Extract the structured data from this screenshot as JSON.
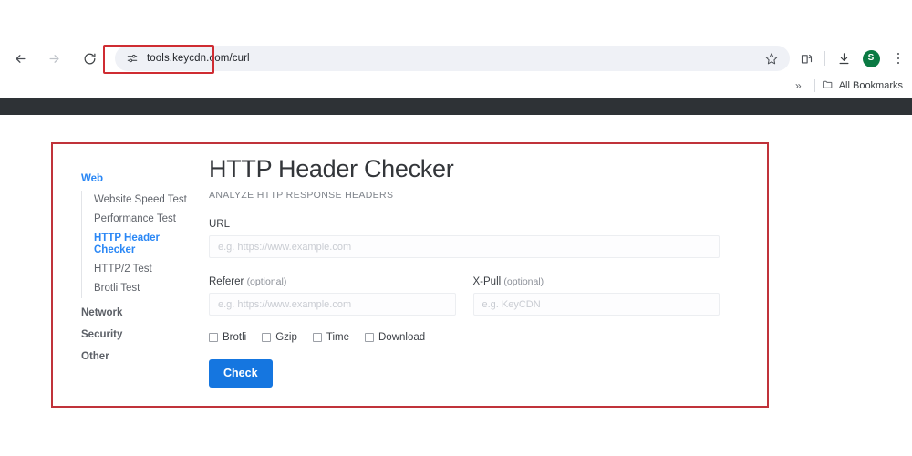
{
  "browser": {
    "nav": {
      "back_icon": "arrow-left-icon",
      "forward_icon": "arrow-right-icon",
      "reload_icon": "reload-icon"
    },
    "omnibox": {
      "site_settings_icon": "tune-sliders-icon",
      "url": "tools.keycdn.com/curl",
      "bookmark_icon": "star-icon"
    },
    "toolbar_right": {
      "share_icon": "share-screen-icon",
      "downloads_icon": "download-icon",
      "profile_initial": "S",
      "menu_icon": "kebab-menu-icon"
    },
    "bookmarks_bar": {
      "overflow_label": "»",
      "folder_icon": "folder-icon",
      "all_bookmarks_label": "All Bookmarks"
    }
  },
  "annotations": {
    "url_highlight_color": "#cf2c32",
    "panel_highlight_color": "#c0323a"
  },
  "site": {
    "navbar_color": "#2e3236",
    "sidebar": {
      "groups": [
        {
          "label": "Web",
          "active": true,
          "items": [
            {
              "label": "Website Speed Test",
              "active": false
            },
            {
              "label": "Performance Test",
              "active": false
            },
            {
              "label": "HTTP Header Checker",
              "active": true
            },
            {
              "label": "HTTP/2 Test",
              "active": false
            },
            {
              "label": "Brotli Test",
              "active": false
            }
          ]
        },
        {
          "label": "Network",
          "active": false,
          "items": []
        },
        {
          "label": "Security",
          "active": false,
          "items": []
        },
        {
          "label": "Other",
          "active": false,
          "items": []
        }
      ]
    },
    "tool": {
      "title": "HTTP Header Checker",
      "subtitle": "ANALYZE HTTP RESPONSE HEADERS",
      "fields": {
        "url": {
          "label": "URL",
          "value": "",
          "placeholder": "e.g. https://www.example.com"
        },
        "referer": {
          "label": "Referer",
          "optional_note": "(optional)",
          "value": "",
          "placeholder": "e.g. https://www.example.com"
        },
        "xpull": {
          "label": "X-Pull",
          "optional_note": "(optional)",
          "value": "",
          "placeholder": "e.g. KeyCDN"
        }
      },
      "checkboxes": [
        {
          "label": "Brotli",
          "checked": false
        },
        {
          "label": "Gzip",
          "checked": false
        },
        {
          "label": "Time",
          "checked": false
        },
        {
          "label": "Download",
          "checked": false
        }
      ],
      "submit_label": "Check",
      "submit_color": "#1576e0"
    }
  }
}
